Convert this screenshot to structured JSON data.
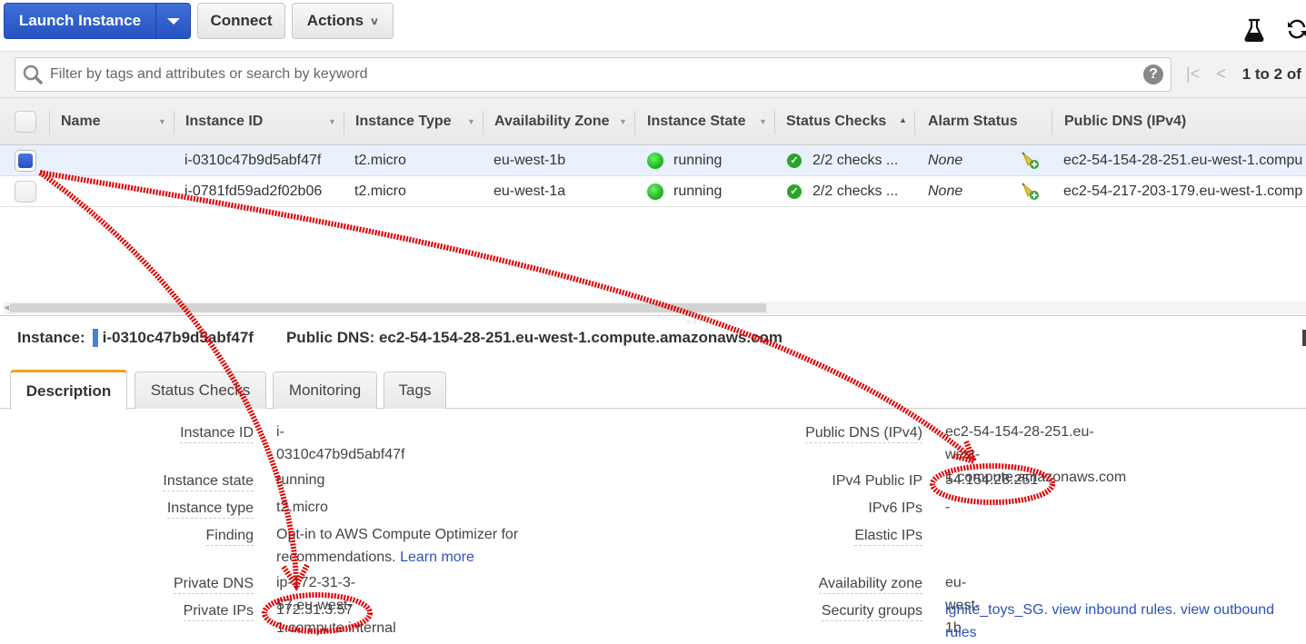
{
  "toolbar": {
    "launch_label": "Launch Instance",
    "connect_label": "Connect",
    "actions_label": "Actions",
    "icons": [
      "flask-icon",
      "refresh-icon"
    ]
  },
  "filter": {
    "placeholder": "Filter by tags and attributes or search by keyword",
    "value": "",
    "pagination": "1 to 2 of"
  },
  "grid": {
    "columns": [
      "Name",
      "Instance ID",
      "Instance Type",
      "Availability Zone",
      "Instance State",
      "Status Checks",
      "Alarm Status",
      "Public DNS (IPv4)"
    ],
    "rows": [
      {
        "selected": true,
        "name": "",
        "instance_id": "i-0310c47b9d5abf47f",
        "instance_type": "t2.micro",
        "az": "eu-west-1b",
        "state": "running",
        "status_checks": "2/2 checks ...",
        "alarm": "None",
        "public_dns": "ec2-54-154-28-251.eu-west-1.compu"
      },
      {
        "selected": false,
        "name": "",
        "instance_id": "i-0781fd59ad2f02b06",
        "instance_type": "t2.micro",
        "az": "eu-west-1a",
        "state": "running",
        "status_checks": "2/2 checks ...",
        "alarm": "None",
        "public_dns": "ec2-54-217-203-179.eu-west-1.comp"
      }
    ]
  },
  "detail": {
    "instance_label": "Instance:",
    "instance_id": "i-0310c47b9d5abf47f",
    "public_dns_label": "Public DNS: ec2-54-154-28-251.eu-west-1.compute.amazonaws.com",
    "tabs": [
      "Description",
      "Status Checks",
      "Monitoring",
      "Tags"
    ],
    "active_tab": "Description",
    "left": {
      "instance_id_label": "Instance ID",
      "instance_id_value": "i-0310c47b9d5abf47f",
      "instance_state_label": "Instance state",
      "instance_state_value": "running",
      "instance_type_label": "Instance type",
      "instance_type_value": "t2.micro",
      "finding_label": "Finding",
      "finding_value": "Opt-in to AWS Compute Optimizer for recommendations.",
      "finding_link": "Learn more",
      "private_dns_label": "Private DNS",
      "private_dns_value": "ip-172-31-3-57.eu-west-1.compute.internal",
      "private_ips_label": "Private IPs",
      "private_ips_value": "172.31.3.57"
    },
    "right": {
      "public_dns_label": "Public DNS (IPv4)",
      "public_dns_line1": "ec2-54-154-28-251.eu-west-",
      "public_dns_line2": "1.compute.amazonaws.com",
      "ipv4_label": "IPv4 Public IP",
      "ipv4_value": "54.154.28.251",
      "ipv6_label": "IPv6 IPs",
      "ipv6_value": "-",
      "elastic_label": "Elastic IPs",
      "elastic_value": "",
      "az_label": "Availability zone",
      "az_value": "eu-west-1b",
      "sg_label": "Security groups",
      "sg_link": "ignite_toys_SG",
      "sg_inbound": "view inbound rules",
      "sg_outbound": "view outbound rules"
    }
  },
  "colors": {
    "primary_button": "#2e5ccb",
    "tab_accent": "#f0a31c",
    "link": "#2e52b8",
    "running": "#14b014",
    "annotation": "#e00000"
  }
}
